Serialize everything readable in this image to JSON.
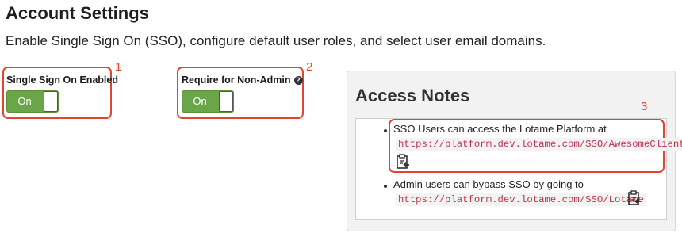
{
  "page": {
    "title": "Account Settings",
    "subtitle": "Enable Single Sign On (SSO), configure default user roles, and select user email domains."
  },
  "settings": {
    "sso_enabled": {
      "label": "Single Sign On Enabled",
      "toggle_text": "On",
      "annotation": "1"
    },
    "require_non_admin": {
      "label": "Require for Non-Admin",
      "help_icon": "?",
      "toggle_text": "On",
      "annotation": "2"
    }
  },
  "access_notes": {
    "title": "Access Notes",
    "annotation": "3",
    "items": [
      {
        "text": "SSO Users can access the Lotame Platform at",
        "url": "https://platform.dev.lotame.com/SSO/AwesomeClient",
        "icon": "clipboard-icon"
      },
      {
        "text": "Admin users can bypass SSO by going to",
        "url": "https://platform.dev.lotame.com/SSO/Lotame",
        "icon": "clipboard-icon"
      }
    ]
  },
  "colors": {
    "toggle_on": "#6ba54a",
    "annotation": "#e2442f",
    "code_text": "#c0304e"
  }
}
